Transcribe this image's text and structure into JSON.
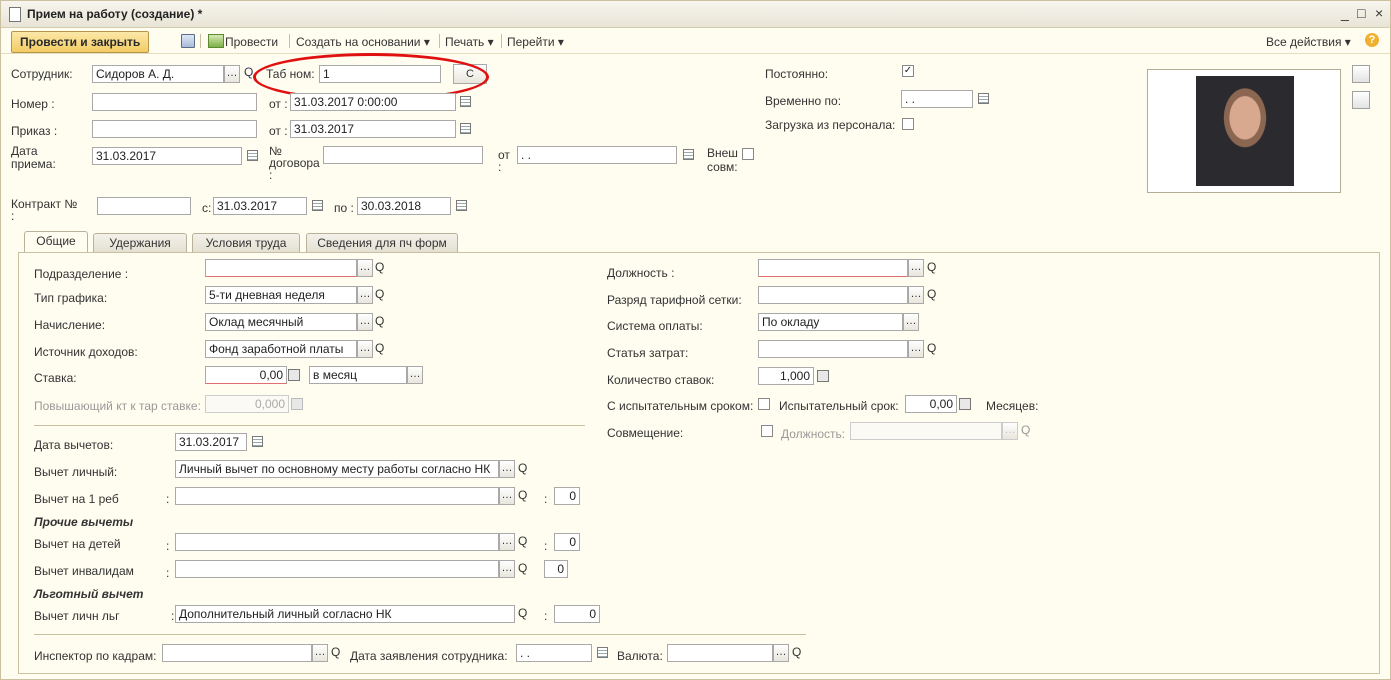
{
  "window": {
    "title": "Прием на работу (создание) *",
    "controls": [
      "_",
      "□",
      "×"
    ]
  },
  "toolbar": {
    "post_close": "Провести и закрыть",
    "post": "Провести",
    "create_based": "Создать на основании ▾",
    "print": "Печать ▾",
    "goto": "Перейти ▾",
    "all_actions": "Все действия ▾",
    "help": "?"
  },
  "header": {
    "employee_label": "Сотрудник:",
    "employee_value": "Сидоров А. Д.",
    "tab_num_label": "Таб ном:",
    "tab_num_value": "1",
    "tab_num_btn": "С",
    "number_label": "Номер  :",
    "number_value": "",
    "from_label": "от :",
    "number_date": "31.03.2017  0:00:00",
    "order_label": "Приказ :",
    "order_value": "",
    "order_date": "31.03.2017",
    "hire_date_label": "Дата\nприема:",
    "hire_date": "31.03.2017",
    "contract_no_label": "№\nдоговора\n:",
    "contract_no_value": "",
    "contract_from_label": "от\n:",
    "contract_from_value": " .  .",
    "ext_label": "Внеш\nсовм:",
    "contract_label": "Контракт №\n:",
    "contract_value": "",
    "contract_s_label": "с:",
    "contract_start": "31.03.2017",
    "contract_po_label": "по :",
    "contract_end": "30.03.2018",
    "permanent_label": "Постоянно:",
    "permanent_checked": "✓",
    "temp_label": "Временно по:",
    "temp_value": " .  .",
    "load_label": "Загрузка из персонала:"
  },
  "tabs": [
    "Общие",
    "Удержания",
    "Условия труда",
    "Сведения для пч форм"
  ],
  "general": {
    "dept_label": "Подразделение :",
    "dept_value": "",
    "schedule_label": "Тип графика:",
    "schedule_value": "5-ти дневная неделя",
    "accrual_label": "Начисление:",
    "accrual_value": "Оклад месячный",
    "income_label": "Источник доходов:",
    "income_value": "Фонд заработной платы",
    "rate_label": "Ставка:",
    "rate_value": "0,00",
    "rate_period": "в месяц",
    "coef_label": "Повышающий кт к тар ставке:",
    "coef_value": "0,000",
    "position_label": "Должность :",
    "position_value": "",
    "grade_label": "Разряд тарифной сетки:",
    "grade_value": "",
    "pay_system_label": "Система оплаты:",
    "pay_system_value": "По окладу",
    "cost_label": "Статья затрат:",
    "cost_value": "",
    "rates_count_label": "Количество ставок:",
    "rates_count_value": "1,000",
    "probation_label": "С испытательным сроком:",
    "probation_term_label": "Испытательный срок:",
    "probation_term_value": "0,00",
    "months_label": "Месяцев:",
    "combo_label": "Совмещение:",
    "combo_pos_label": "Должность:",
    "combo_pos_value": ""
  },
  "deductions": {
    "date_label": "Дата вычетов:",
    "date_value": "31.03.2017",
    "personal_label": "Вычет личный:",
    "personal_value": "Личный вычет по основному месту работы согласно НК",
    "child1_label": "Вычет на 1 реб",
    "child1_value": "",
    "child1_count": "0",
    "other_header": "Прочие вычеты",
    "children_label": "Вычет на детей",
    "children_value": "",
    "children_count": "0",
    "disabled_label": "Вычет инвалидам",
    "disabled_value": "",
    "disabled_count": "0",
    "benefit_header": "Льготный вычет",
    "benefit_label": "Вычет личн льг",
    "benefit_value": "Дополнительный личный согласно НК",
    "benefit_count": "0",
    "colon": ":"
  },
  "footer": {
    "inspector_label": "Инспектор по кадрам:",
    "inspector_value": "",
    "app_date_label": "Дата заявления сотрудника:",
    "app_date_value": " .  .",
    "currency_label": "Валюта:",
    "currency_value": ""
  },
  "colors": {
    "accent_button": "#f3cc63",
    "highlight_ellipse": "#e01010",
    "window_bg": "#fffdf0"
  }
}
